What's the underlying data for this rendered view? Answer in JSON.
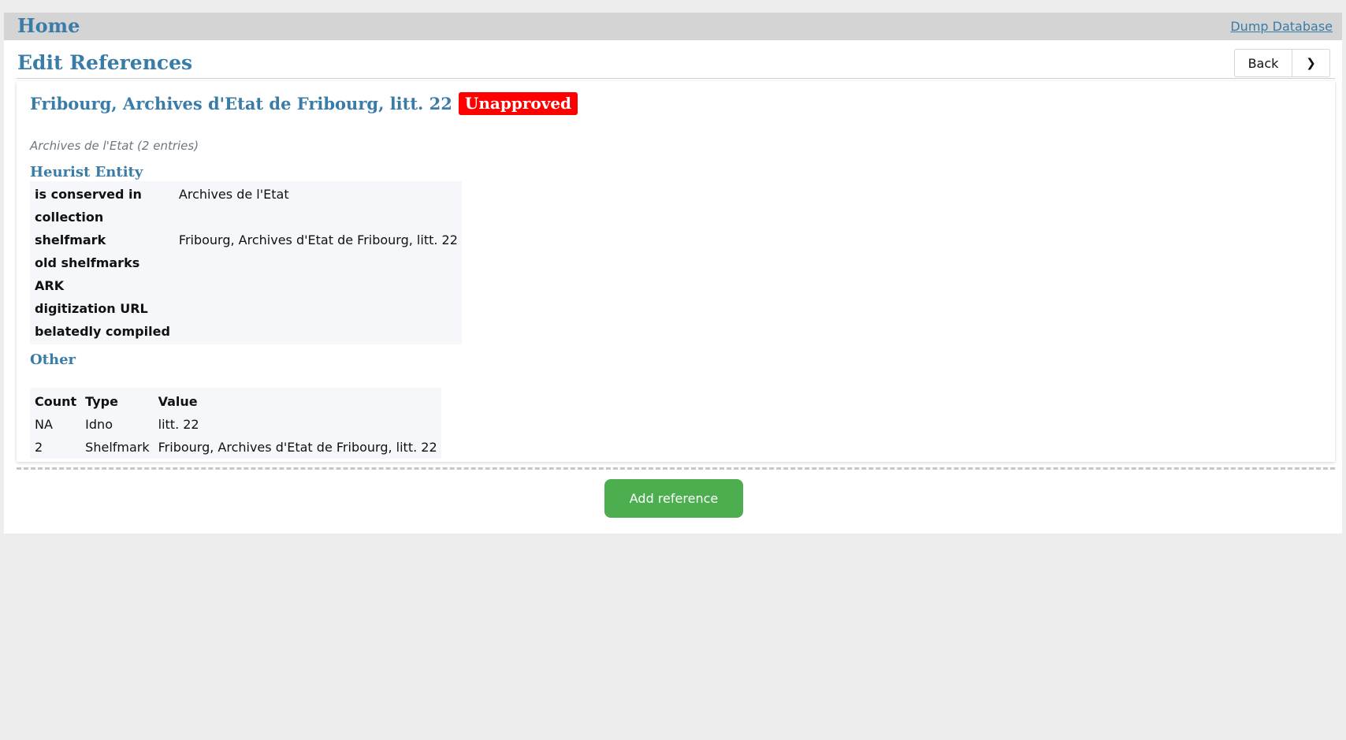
{
  "topbar": {
    "home_label": "Home",
    "dump_label": "Dump Database"
  },
  "header": {
    "title": "Edit References",
    "back_label": "Back",
    "next_label": "❯"
  },
  "record": {
    "title": "Fribourg, Archives d'Etat de Fribourg, litt. 22",
    "status_badge": "Unapproved",
    "status_color": "#ff0000",
    "subtitle": "Archives de l'Etat (2 entries)"
  },
  "heurist": {
    "heading": "Heurist Entity",
    "rows": [
      {
        "key": "is conserved in",
        "value": "Archives de l'Etat"
      },
      {
        "key": "collection",
        "value": ""
      },
      {
        "key": "shelfmark",
        "value": "Fribourg, Archives d'Etat de Fribourg, litt. 22"
      },
      {
        "key": "old shelfmarks",
        "value": ""
      },
      {
        "key": "ARK",
        "value": ""
      },
      {
        "key": "digitization URL",
        "value": ""
      },
      {
        "key": "belatedly compiled",
        "value": ""
      }
    ]
  },
  "other": {
    "heading": "Other",
    "columns": [
      "Count",
      "Type",
      "Value"
    ],
    "rows": [
      [
        "NA",
        "Idno",
        "litt. 22"
      ],
      [
        "2",
        "Shelfmark",
        "Fribourg, Archives d'Etat de Fribourg, litt. 22"
      ]
    ]
  },
  "actions": {
    "add_reference_label": "Add reference",
    "add_color": "#4cae4f"
  },
  "colors": {
    "accent": "#3a7ca8",
    "topbar": "#d4d4d4",
    "background": "#ededed"
  }
}
